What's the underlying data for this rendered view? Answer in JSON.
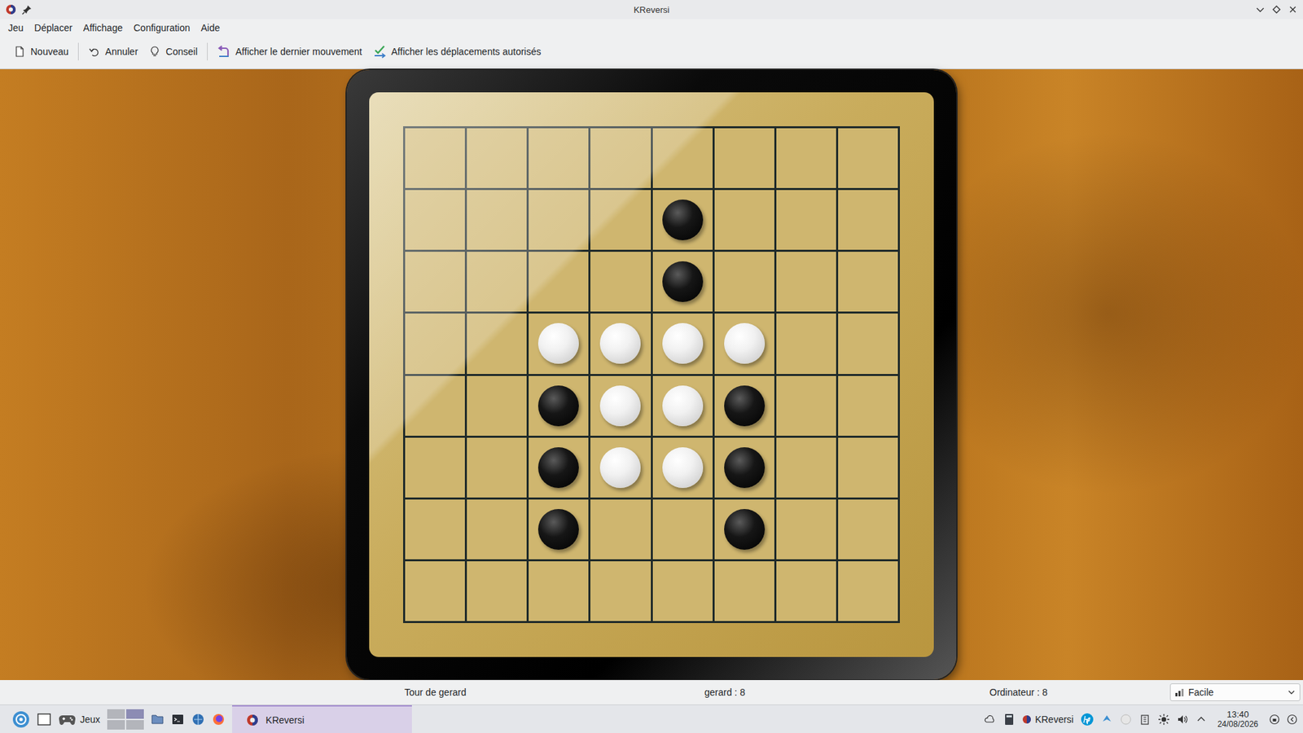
{
  "window": {
    "title": "KReversi"
  },
  "menu": [
    "Jeu",
    "Déplacer",
    "Affichage",
    "Configuration",
    "Aide"
  ],
  "toolbar": [
    [
      "Nouveau"
    ],
    [
      "Annuler",
      "Conseil"
    ],
    [
      "Afficher le dernier mouvement",
      "Afficher les déplacements autorisés"
    ]
  ],
  "board": {
    "rows": [
      [
        "empty",
        "empty",
        "empty",
        "empty",
        "empty",
        "empty",
        "empty",
        "empty"
      ],
      [
        "empty",
        "empty",
        "empty",
        "empty",
        "black",
        "empty",
        "empty",
        "empty"
      ],
      [
        "empty",
        "empty",
        "empty",
        "empty",
        "black",
        "empty",
        "empty",
        "empty"
      ],
      [
        "empty",
        "empty",
        "white",
        "white",
        "white",
        "white",
        "empty",
        "empty"
      ],
      [
        "empty",
        "empty",
        "black",
        "white",
        "white",
        "black",
        "empty",
        "empty"
      ],
      [
        "empty",
        "empty",
        "black",
        "white",
        "white",
        "black",
        "empty",
        "empty"
      ],
      [
        "empty",
        "empty",
        "black",
        "empty",
        "empty",
        "black",
        "empty",
        "empty"
      ],
      [
        "empty",
        "empty",
        "empty",
        "empty",
        "empty",
        "empty",
        "empty",
        "empty"
      ]
    ]
  },
  "status_bar": {
    "turn": "Tour de gerard",
    "player_score": "gerard : 8",
    "computer_score": "Ordinateur : 8",
    "difficulty": "Facile"
  },
  "taskbar": {
    "launcher_label": "Jeux",
    "pager": [
      {
        "selected": false
      },
      {
        "selected": true
      },
      {
        "selected": false
      },
      {
        "selected": false
      }
    ],
    "tasks": [
      {
        "label": "KReversi",
        "selected": true
      }
    ],
    "tray_app": "KReversi",
    "clock": {
      "time": "13:40",
      "date": "24/08/2026"
    }
  }
}
